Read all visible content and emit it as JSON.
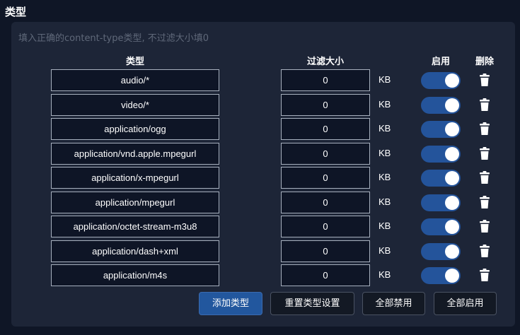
{
  "section_title": "类型",
  "hint": "填入正确的content-type类型, 不过滤大小填0",
  "headers": {
    "type": "类型",
    "size": "过滤大小",
    "enabled": "启用",
    "delete": "删除"
  },
  "unit": "KB",
  "rows": [
    {
      "type": "audio/*",
      "size": "0",
      "enabled": true
    },
    {
      "type": "video/*",
      "size": "0",
      "enabled": true
    },
    {
      "type": "application/ogg",
      "size": "0",
      "enabled": true
    },
    {
      "type": "application/vnd.apple.mpegurl",
      "size": "0",
      "enabled": true
    },
    {
      "type": "application/x-mpegurl",
      "size": "0",
      "enabled": true
    },
    {
      "type": "application/mpegurl",
      "size": "0",
      "enabled": true
    },
    {
      "type": "application/octet-stream-m3u8",
      "size": "0",
      "enabled": true
    },
    {
      "type": "application/dash+xml",
      "size": "0",
      "enabled": true
    },
    {
      "type": "application/m4s",
      "size": "0",
      "enabled": true
    }
  ],
  "buttons": {
    "add": "添加类型",
    "reset": "重置类型设置",
    "disable_all": "全部禁用",
    "enable_all": "全部启用"
  },
  "colors": {
    "accent": "#24549b",
    "background": "#1d2537"
  }
}
